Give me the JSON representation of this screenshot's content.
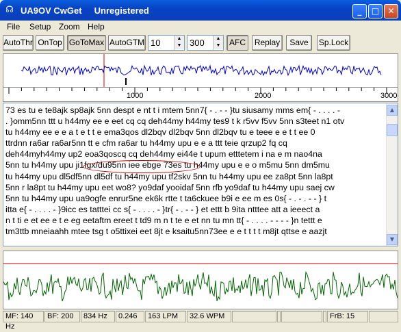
{
  "window": {
    "title": "UA9OV CwGet     Unregistered",
    "min_label": "_",
    "max_label": "□",
    "close_label": "✕"
  },
  "menu": [
    "File",
    "Setup",
    "Zoom",
    "Help"
  ],
  "toolbar": {
    "autothr": "AutoThr",
    "ontop": "OnTop",
    "gotomax": "GoToMax",
    "autogtm": "AutoGTM",
    "spin1": "10",
    "spin2": "300",
    "afc": "AFC",
    "replay": "Replay",
    "save": "Save",
    "splock": "Sp.Lock"
  },
  "ruler": {
    "labels": [
      "1000",
      "2000",
      "3000"
    ]
  },
  "decoded_text": [
    "73 es tu e te8ajk sp8ajk 5nn despt e nt t i mtem 5nn7{ - . - - }tu siusamy mms em{ - . . . . -",
    ". }omm5nn ttt u h44my ee e eet cq cq deh44my h44my tes9 t k r5vv f5vv 5nn s3teet n1 otv",
    "tu h44my ee e e a t e t t e ema3qos dl2bqv dl2bqv 5nn dl2bqv tu e teee e e t t ee 0",
    "ttrdnn ra6ar ra6ar5nn tt e cfm ra6ar tu h44my upu e e a ttt teie qrzup2 fq cq",
    "deh44myh44my up2 eoa3qoscq cq deh44my ei44e t upum etttetem i na e m nao4na",
    "5nn tu h44my upu ji1fgx/du95nn iee ebge 73es tu h44my upu e e o m5mu 5nn dm5mu",
    "tu h44my upu dl5df5nn dl5df tu h44my upu tf2skv 5nn tu h44my upu ee za8pt 5nn la8pt",
    "5nn r la8pt tu h44my upu eet wo8? yo9daf yooidaf 5nn rfb yo9daf tu h44my upu saej cw",
    "5nn tu h44my upu ua9ogfe enrur5ne ek6k rtte t ta6ckuee b9i e ee m es 0s{ - . - . - - } t",
    "itta e{ - . . . . - }9icc es tatttei cc s{ - . . . . - }tr{ - . - - } et ettt b 9ita ntttee att a ieeect a",
    "n t ti e et ee e t e eg eetaftm ereet t td9 m n t te e et nn tu mn tt{ - . . . . - - - - }n tettt e",
    "tm3ttb mneiaahh mtee tsg t o5ttixei eet 8jt e ksaitu5nn73ee e e t t t t m8jt qttse e aazjt"
  ],
  "status": {
    "mf": "MF: 140 Hz",
    "bf": "BF: 200",
    "freq": "834 Hz",
    "level": "0.246",
    "lpm": "163 LPM",
    "wpm": "32.6 WPM",
    "frb": "FrB: 15"
  },
  "colors": {
    "title_bar": "#0a4fd8",
    "spectrum_trace": "#0000c0",
    "scope_trace": "#006400",
    "marker": "#d00000"
  }
}
